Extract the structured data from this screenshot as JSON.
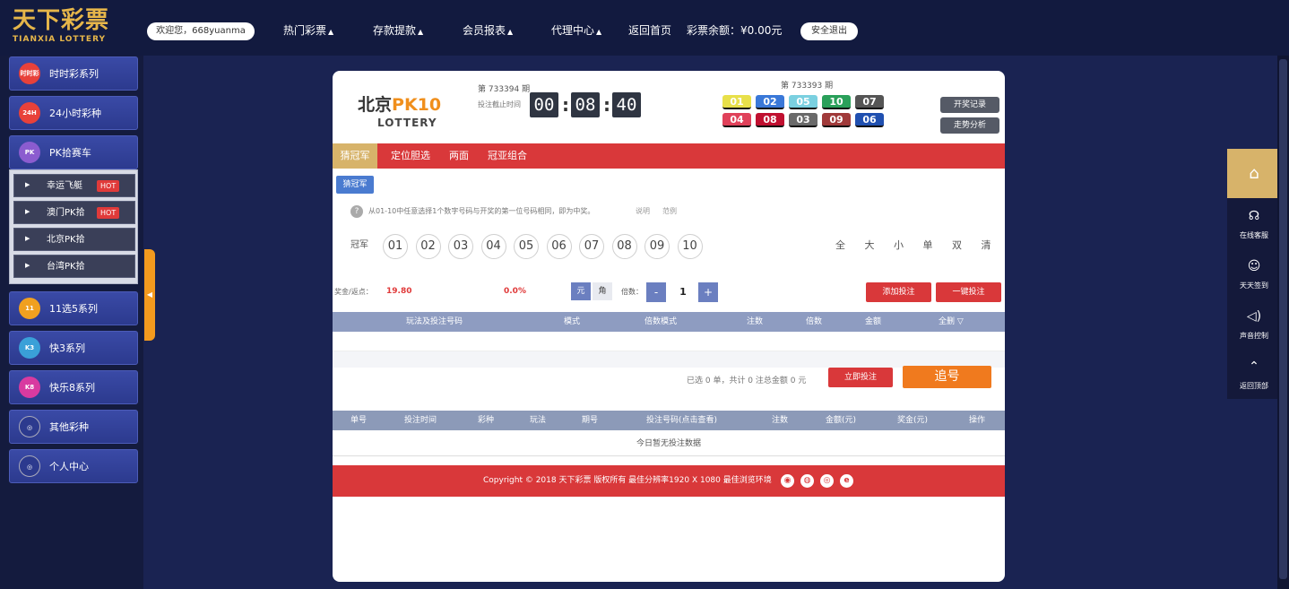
{
  "header": {
    "logo_cn": "天下彩票",
    "logo_en": "TIANXIA LOTTERY",
    "welcome": "欢迎您，668yuanma",
    "nav": [
      "热门彩票",
      "存款提款",
      "会员报表",
      "代理中心"
    ],
    "home_link": "返回首页",
    "balance_label": "彩票余额：",
    "balance_value": "¥0.00元",
    "logout": "安全退出"
  },
  "sidebar": {
    "items": [
      {
        "label": "时时彩系列",
        "icon": "ssc-icon",
        "color": "#e8413a",
        "icon_text": "时时彩"
      },
      {
        "label": "24小时彩种",
        "icon": "24h-icon",
        "color": "#e8413a",
        "icon_text": "24H"
      },
      {
        "label": "PK拾赛车",
        "icon": "pk10-icon",
        "color": "#8b5ccf",
        "icon_text": "PK"
      },
      {
        "label": "11选5系列",
        "icon": "11x5-icon",
        "color": "#f0a020",
        "icon_text": "11"
      },
      {
        "label": "快3系列",
        "icon": "k3-icon",
        "color": "#3aa0d8",
        "icon_text": "K3"
      },
      {
        "label": "快乐8系列",
        "icon": "kl8-icon",
        "color": "#d83aa0",
        "icon_text": "K8"
      },
      {
        "label": "其他彩种",
        "icon": "other-icon",
        "color": "#2c3a8e",
        "icon_text": "◎"
      },
      {
        "label": "个人中心",
        "icon": "user-center-icon",
        "color": "#2c3a8e",
        "icon_text": "◎"
      }
    ],
    "sub_items": [
      {
        "label": "幸运飞艇",
        "hot": "HOT"
      },
      {
        "label": "澳门PK拾",
        "hot": "HOT"
      },
      {
        "label": "北京PK拾",
        "hot": ""
      },
      {
        "label": "台湾PK拾",
        "hot": ""
      }
    ]
  },
  "game": {
    "brand_cn": "北京",
    "brand_hl": "PK10",
    "brand_en": "LOTTERY",
    "current_issue": "第 733394 期",
    "deadline_label": "投注截止时间",
    "countdown": [
      "00",
      "08",
      "40"
    ],
    "prev_issue": "第 733393 期",
    "balls": [
      {
        "n": "01",
        "c": "#e8e04a"
      },
      {
        "n": "02",
        "c": "#3a78d8"
      },
      {
        "n": "05",
        "c": "#7ad0e0"
      },
      {
        "n": "10",
        "c": "#2aa05a"
      },
      {
        "n": "07",
        "c": "#555555"
      },
      {
        "n": "04",
        "c": "#e0415a"
      },
      {
        "n": "08",
        "c": "#c01030"
      },
      {
        "n": "03",
        "c": "#6a6a6a"
      },
      {
        "n": "09",
        "c": "#a03a3a"
      },
      {
        "n": "06",
        "c": "#2050b0"
      }
    ],
    "draw_history_btn": "开奖记录",
    "trend_btn": "走势分析",
    "tabs": [
      "猜冠军",
      "定位胆选",
      "两面",
      "冠亚组合"
    ],
    "sub_tab": "猜冠军",
    "hint": "从01-10中任意选择1个数字号码与开奖的第一位号码相同，即为中奖。",
    "hint_link_1": "说明",
    "hint_link_2": "范例",
    "row_label": "冠军",
    "numbers": [
      "01",
      "02",
      "03",
      "04",
      "05",
      "06",
      "07",
      "08",
      "09",
      "10"
    ],
    "quick_select": [
      "全",
      "大",
      "小",
      "单",
      "双",
      "清"
    ],
    "rebate_label": "奖金/返点：",
    "rebate_value": "19.80",
    "rebate_pct": "0.0%",
    "unit_yuan": "元",
    "unit_jiao": "角",
    "multiplier_label": "倍数：",
    "multiplier_minus": "-",
    "multiplier_value": "1",
    "multiplier_plus": "+",
    "add_bet_btn": "添加投注",
    "quick_bet_btn": "一键投注",
    "cart_headers": [
      "玩法及投注号码",
      "模式",
      "倍数模式",
      "注数",
      "倍数",
      "金额",
      "全删 ▽"
    ],
    "summary": "已选 0 单，共计 0 注总金额 0 元",
    "submit_btn": "立即投注",
    "chase_btn": "追号",
    "history_headers": [
      "单号",
      "投注时间",
      "彩种",
      "玩法",
      "期号",
      "投注号码(点击查看)",
      "注数",
      "金额(元)",
      "奖金(元)",
      "操作"
    ],
    "empty_msg": "今日暂无投注数据",
    "footer": "Copyright © 2018 天下彩票 版权所有   最佳分辨率1920 X 1080 最佳浏览环境"
  },
  "right_panel": {
    "home_icon": "⌂",
    "items": [
      {
        "label": "在线客服",
        "icon": "headset-icon",
        "glyph": "☊"
      },
      {
        "label": "天天签到",
        "icon": "smile-icon",
        "glyph": "☺"
      },
      {
        "label": "声音控制",
        "icon": "speaker-icon",
        "glyph": "◁)"
      },
      {
        "label": "返回顶部",
        "icon": "back-to-top-icon",
        "glyph": "⌃"
      }
    ]
  },
  "colors": {
    "red": "#d9383a",
    "gold": "#d7b36a",
    "orange": "#f07a1e",
    "nav_bg": "#121a3f"
  }
}
